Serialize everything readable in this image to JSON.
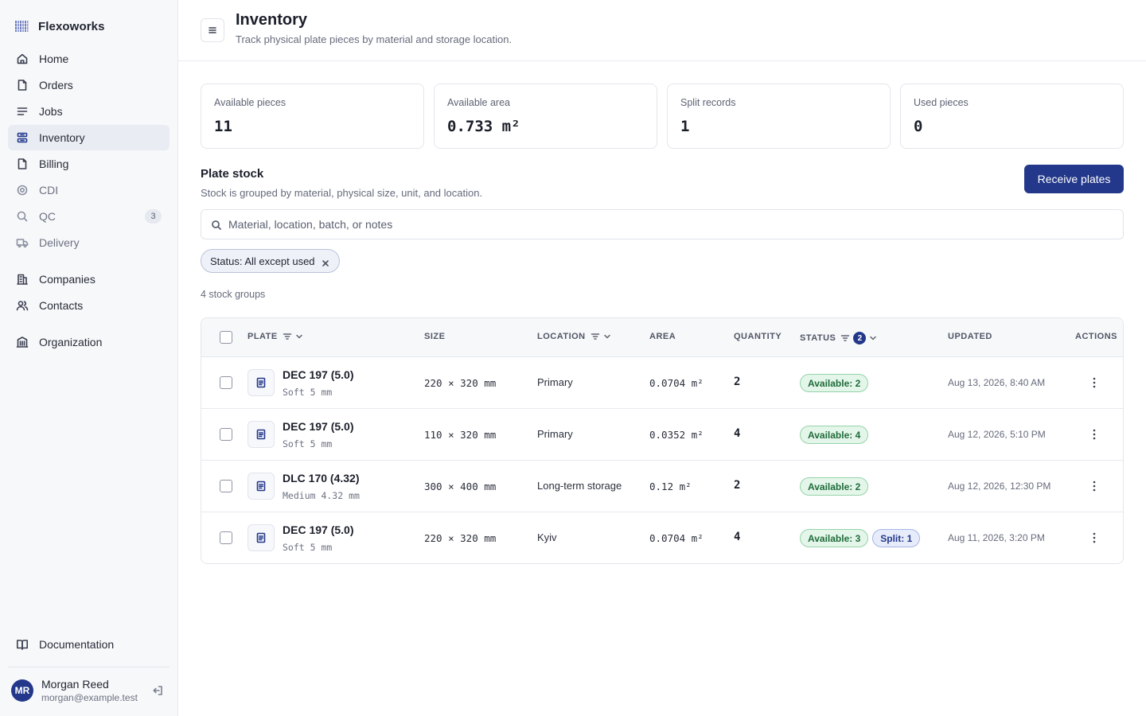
{
  "app": {
    "name": "Flexoworks"
  },
  "sidebar": {
    "items": [
      {
        "label": "Home",
        "icon": "home-icon"
      },
      {
        "label": "Orders",
        "icon": "file-icon"
      },
      {
        "label": "Jobs",
        "icon": "list-icon"
      },
      {
        "label": "Inventory",
        "icon": "inventory-icon",
        "active": true
      },
      {
        "label": "Billing",
        "icon": "file-icon"
      },
      {
        "label": "CDI",
        "icon": "target-icon"
      },
      {
        "label": "QC",
        "icon": "search-icon",
        "badge": "3"
      },
      {
        "label": "Delivery",
        "icon": "truck-icon"
      },
      {
        "label": "Companies",
        "icon": "building-icon"
      },
      {
        "label": "Contacts",
        "icon": "users-icon"
      },
      {
        "label": "Organization",
        "icon": "organization-icon"
      }
    ],
    "documentation": "Documentation",
    "user": {
      "initials": "MR",
      "name": "Morgan Reed",
      "email": "morgan@example.test"
    }
  },
  "header": {
    "title": "Inventory",
    "subtitle": "Track physical plate pieces by material and storage location."
  },
  "stats": [
    {
      "label": "Available pieces",
      "value": "11"
    },
    {
      "label": "Available area",
      "value": "0.733 m²"
    },
    {
      "label": "Split records",
      "value": "1"
    },
    {
      "label": "Used pieces",
      "value": "0"
    }
  ],
  "section": {
    "title": "Plate stock",
    "subtitle": "Stock is grouped by material, physical size, unit, and location.",
    "receive_label": "Receive plates"
  },
  "search": {
    "placeholder": "Material, location, batch, or notes",
    "value": ""
  },
  "filter_chip": {
    "label": "Status: All except used"
  },
  "count_text": "4 stock groups",
  "table": {
    "columns": {
      "plate": "PLATE",
      "size": "SIZE",
      "location": "LOCATION",
      "area": "AREA",
      "quantity": "QUANTITY",
      "status": "STATUS",
      "status_filter_count": "2",
      "updated": "UPDATED",
      "actions": "ACTIONS"
    },
    "rows": [
      {
        "plate": "DEC 197 (5.0)",
        "plate_sub": "Soft 5 mm",
        "size": "220 × 320 mm",
        "location": "Primary",
        "area": "0.0704 m²",
        "quantity": "2",
        "statuses": [
          {
            "type": "avail",
            "label": "Available: 2"
          }
        ],
        "updated": "Aug 13, 2026, 8:40 AM"
      },
      {
        "plate": "DEC 197 (5.0)",
        "plate_sub": "Soft 5 mm",
        "size": "110 × 320 mm",
        "location": "Primary",
        "area": "0.0352 m²",
        "quantity": "4",
        "statuses": [
          {
            "type": "avail",
            "label": "Available: 4"
          }
        ],
        "updated": "Aug 12, 2026, 5:10 PM"
      },
      {
        "plate": "DLC 170 (4.32)",
        "plate_sub": "Medium 4.32 mm",
        "size": "300 × 400 mm",
        "location": "Long-term storage",
        "area": "0.12 m²",
        "quantity": "2",
        "statuses": [
          {
            "type": "avail",
            "label": "Available: 2"
          }
        ],
        "updated": "Aug 12, 2026, 12:30 PM"
      },
      {
        "plate": "DEC 197 (5.0)",
        "plate_sub": "Soft 5 mm",
        "size": "220 × 320 mm",
        "location": "Kyiv",
        "area": "0.0704 m²",
        "quantity": "4",
        "statuses": [
          {
            "type": "avail",
            "label": "Available: 3"
          },
          {
            "type": "split",
            "label": "Split: 1"
          }
        ],
        "updated": "Aug 11, 2026, 3:20 PM"
      }
    ]
  },
  "colors": {
    "accent": "#23388a",
    "available": "#1f6b3a",
    "split": "#23388a"
  }
}
